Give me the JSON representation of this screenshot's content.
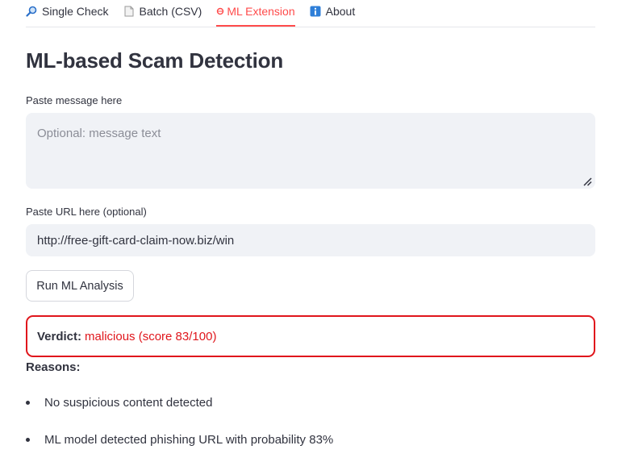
{
  "tabs": [
    {
      "label": "Single Check",
      "icon": "magnifier-icon",
      "active": false
    },
    {
      "label": "Batch (CSV)",
      "icon": "document-icon",
      "active": false
    },
    {
      "label": "ML Extension",
      "icon": "circle-icon",
      "active": true
    },
    {
      "label": "About",
      "icon": "info-icon",
      "active": false
    }
  ],
  "page_title": "ML-based Scam Detection",
  "message": {
    "label": "Paste message here",
    "placeholder": "Optional: message text",
    "value": ""
  },
  "url": {
    "label": "Paste URL here (optional)",
    "value": "http://free-gift-card-claim-now.biz/win"
  },
  "run_button_label": "Run ML Analysis",
  "verdict": {
    "label": "Verdict:",
    "value": "malicious (score 83/100)"
  },
  "reasons": {
    "title": "Reasons:",
    "items": [
      "No suspicious content detected",
      "ML model detected phishing URL with probability 83%"
    ]
  },
  "colors": {
    "accent": "#ff4b4b",
    "danger": "#e0161c",
    "input_bg": "#f0f2f6",
    "text": "#31333f"
  }
}
